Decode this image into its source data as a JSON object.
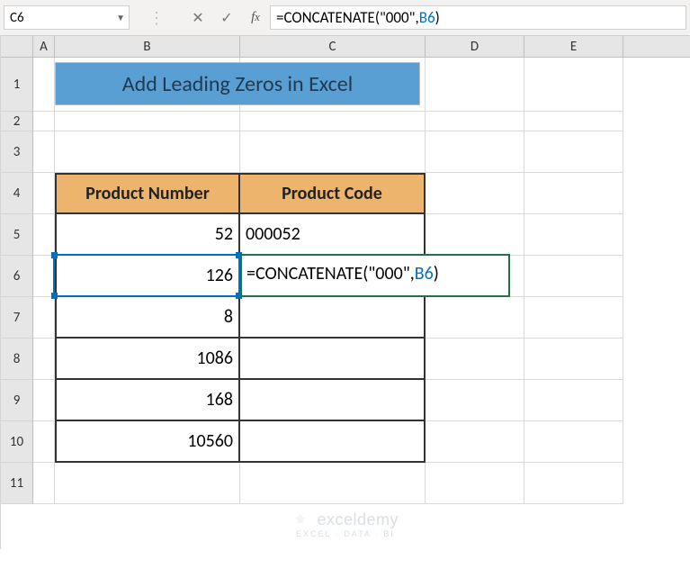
{
  "nameBox": {
    "value": "C6"
  },
  "formulaBar": {
    "prefix": "=CONCATENATE(\"000\",",
    "ref": "B6",
    "suffix": ")"
  },
  "columns": {
    "A": "A",
    "B": "B",
    "C": "C",
    "D": "D",
    "E": "E"
  },
  "rowNums": [
    "1",
    "2",
    "3",
    "4",
    "5",
    "6",
    "7",
    "8",
    "9",
    "10",
    "11"
  ],
  "title": "Add Leading Zeros in Excel",
  "headers": {
    "b": "Product Number",
    "c": "Product Code"
  },
  "table": {
    "r5": {
      "b": "52",
      "c": "000052"
    },
    "r6": {
      "b": "126"
    },
    "r7": {
      "b": "8"
    },
    "r8": {
      "b": "1086"
    },
    "r9": {
      "b": "168"
    },
    "r10": {
      "b": "10560"
    }
  },
  "editing": {
    "prefix": "=CONCATENATE(\"000\",",
    "ref": "B6",
    "suffix": ")"
  },
  "watermark": {
    "main": "exceldemy",
    "sub": "EXCEL · DATA · BI"
  },
  "chart_data": {
    "type": "table",
    "title": "Add Leading Zeros in Excel",
    "columns": [
      "Product Number",
      "Product Code"
    ],
    "rows": [
      [
        52,
        "000052"
      ],
      [
        126,
        "=CONCATENATE(\"000\",B6)"
      ],
      [
        8,
        ""
      ],
      [
        1086,
        ""
      ],
      [
        168,
        ""
      ],
      [
        10560,
        ""
      ]
    ]
  }
}
